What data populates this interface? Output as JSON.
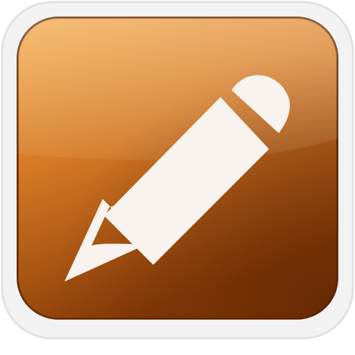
{
  "icon": {
    "name": "pencil-app-icon",
    "glyph": "pencil-icon"
  },
  "colors": {
    "frame_outer": "#f1f1f1",
    "frame_border": "#e2e2e2",
    "tile_border": "#6e3206",
    "tile_top": "#f0a23c",
    "tile_mid": "#cf7220",
    "tile_bottom": "#8e3f08",
    "tile_corner_dark": "#5c2404",
    "glyph_fill": "#f8f3ee"
  }
}
